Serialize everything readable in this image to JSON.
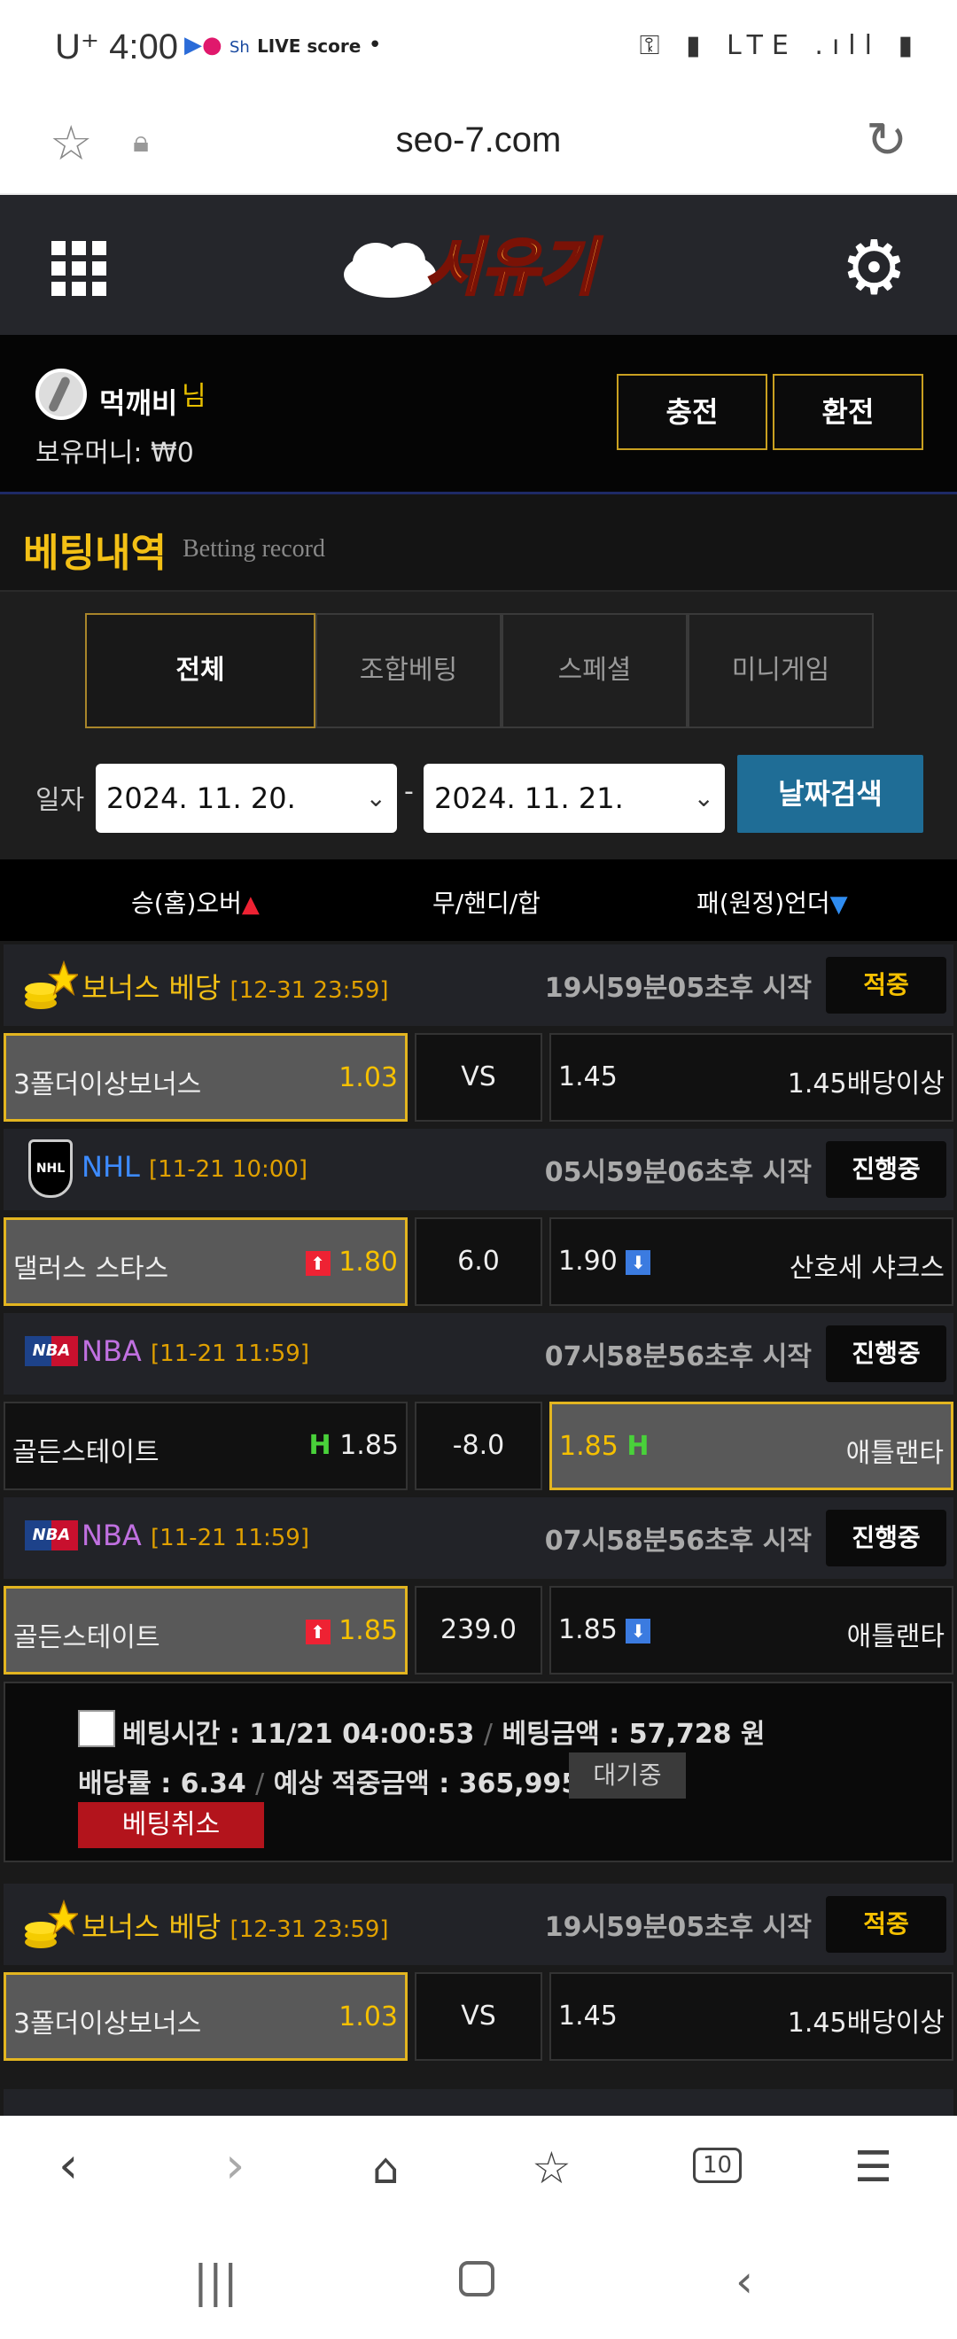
{
  "status_bar": {
    "time": "4:00",
    "carrier": "U⁺",
    "live": "LIVE score",
    "right_icons": "⚿ ▮ LTE .ıll ▮"
  },
  "browser": {
    "url": "seo-7.com"
  },
  "site": {
    "logo_text": "서유기"
  },
  "user": {
    "name": "먹깨비",
    "honorific": "님",
    "money_label": "보유머니: ₩0",
    "charge_label": "충전",
    "exchange_label": "환전"
  },
  "page": {
    "title": "베팅내역",
    "subtitle": "Betting record"
  },
  "tabs": [
    "전체",
    "조합베팅",
    "스페셜",
    "미니게임"
  ],
  "date_filter": {
    "label": "일자",
    "from": "2024. 11. 20.",
    "to": "2024. 11. 21.",
    "dash": "-",
    "search_label": "날짜검색"
  },
  "columns": {
    "home": "승(홈)오버",
    "draw": "무/핸디/합",
    "away": "패(원정)언더"
  },
  "cards": [
    {
      "league": "보너스 베당",
      "time": "[12-31 23:59]",
      "start": "19시59분05초후 시작",
      "status": "적중",
      "home": "3폴더이상보너스",
      "home_odd": "1.03",
      "mid": "VS",
      "away_odd": "1.45",
      "away": "1.45배당이상"
    },
    {
      "league": "NHL",
      "time": "[11-21 10:00]",
      "start": "05시59분06초후 시작",
      "status": "진행중",
      "home": "댈러스 스타스",
      "home_odd": "1.80",
      "mid": "6.0",
      "away_odd": "1.90",
      "away": "산호세 샤크스"
    },
    {
      "league": "NBA",
      "time": "[11-21 11:59]",
      "start": "07시58분56초후 시작",
      "status": "진행중",
      "home": "골든스테이트",
      "home_odd": "1.85",
      "mid": "-8.0",
      "away_odd": "1.85",
      "away": "애틀랜타"
    },
    {
      "league": "NBA",
      "time": "[11-21 11:59]",
      "start": "07시58분56초후 시작",
      "status": "진행중",
      "home": "골든스테이트",
      "home_odd": "1.85",
      "mid": "239.0",
      "away_odd": "1.85",
      "away": "애틀랜타"
    },
    {
      "league": "보너스 베당",
      "time": "[12-31 23:59]",
      "start": "19시59분05초후 시작",
      "status": "적중",
      "home": "3폴더이상보너스",
      "home_odd": "1.03",
      "mid": "VS",
      "away_odd": "1.45",
      "away": "1.45배당이상"
    }
  ],
  "bet_summary": {
    "time_label": "베팅시간 : 11/21 04:00:53",
    "amount_label": "베팅금액 : 57,728 원",
    "rate_label": "배당률 : 6.34",
    "expected_label": "예상 적중금액 : 365,995 원",
    "sep": "/",
    "waiting_label": "대기중",
    "cancel_label": "베팅취소"
  },
  "colors": {
    "gold": "#f3c015",
    "accent_blue": "#1f6d96",
    "red": "#b3141c"
  },
  "icons": {
    "browser_nav": [
      "chevron-left-icon",
      "chevron-right-icon",
      "home-icon",
      "bookmark-star-icon",
      "tabs-icon",
      "menu-icon"
    ],
    "tabs_count": "10"
  }
}
